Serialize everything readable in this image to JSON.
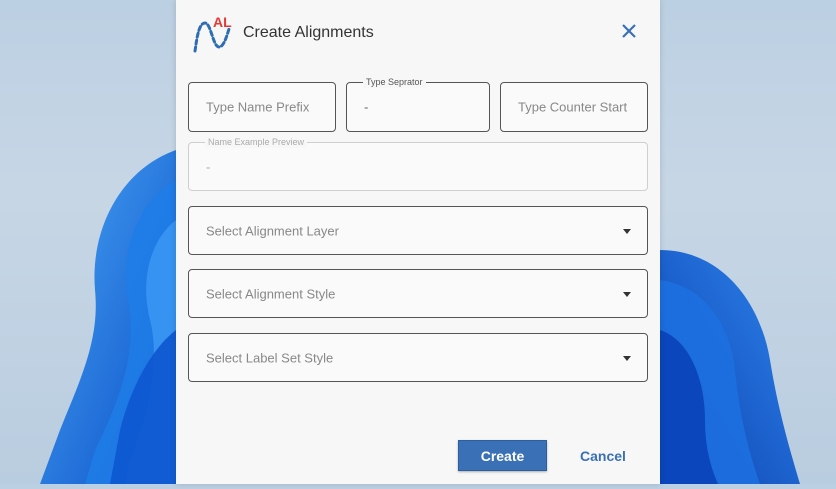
{
  "dialog": {
    "title": "Create Alignments",
    "logo_text": "AL",
    "close_icon": "close-icon"
  },
  "fields": {
    "name_prefix": {
      "placeholder": "Type Name Prefix"
    },
    "separator": {
      "legend": "Type Seprator",
      "value": "-"
    },
    "counter_start": {
      "placeholder": "Type Counter Start"
    },
    "name_preview": {
      "legend": "Name Example Preview",
      "value": "-"
    },
    "alignment_layer": {
      "placeholder": "Select Alignment Layer"
    },
    "alignment_style": {
      "placeholder": "Select Alignment Style"
    },
    "label_set_style": {
      "placeholder": "Select Label Set Style"
    }
  },
  "buttons": {
    "create": "Create",
    "cancel": "Cancel"
  },
  "colors": {
    "accent": "#3a70b5",
    "logo_red": "#e53935",
    "logo_blue": "#2f6db3"
  }
}
